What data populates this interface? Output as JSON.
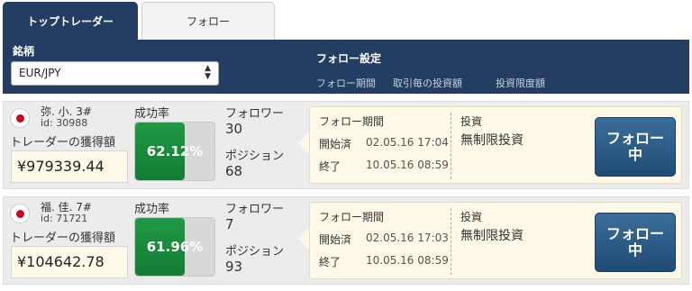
{
  "tabs": {
    "top_traders": "トップトレーダー",
    "follow": "フォロー"
  },
  "header": {
    "symbol_label": "銘柄",
    "symbol_value": "EUR/JPY",
    "follow_settings_title": "フォロー設定",
    "columns": [
      "フォロー期間",
      "取引毎の投資額",
      "投資限度額"
    ]
  },
  "traders": [
    {
      "name": "弥. 小.  3#",
      "id": "id: 30988",
      "earnings_label": "トレーダーの獲得額",
      "earnings": "¥979339.44",
      "success_label": "成功率",
      "success_rate": "62.12%",
      "success_fraction": 0.6212,
      "followers_label": "フォロワー",
      "followers": "30",
      "positions_label": "ポジション",
      "positions": "68",
      "follow_period_label": "フォロー期間",
      "start_label": "開始済",
      "start_value": "02.05.16 17:04",
      "end_label": "終了",
      "end_value": "10.05.16 08:59",
      "investment_label": "投資",
      "investment_value": "無制限投資",
      "button": "フォロー中"
    },
    {
      "name": "福. 佳.  7#",
      "id": "id: 71721",
      "earnings_label": "トレーダーの獲得額",
      "earnings": "¥104642.78",
      "success_label": "成功率",
      "success_rate": "61.96%",
      "success_fraction": 0.6196,
      "followers_label": "フォロワー",
      "followers": "7",
      "positions_label": "ポジション",
      "positions": "93",
      "follow_period_label": "フォロー期間",
      "start_label": "開始済",
      "start_value": "02.05.16 17:03",
      "end_label": "終了",
      "end_value": "10.05.16 08:59",
      "investment_label": "投資",
      "investment_value": "無制限投資",
      "button": "フォロー中"
    }
  ],
  "colors": {
    "navy": "#233d63",
    "green": "#1f9a45",
    "button": "#2c5d88",
    "panel": "#fff9ea"
  }
}
